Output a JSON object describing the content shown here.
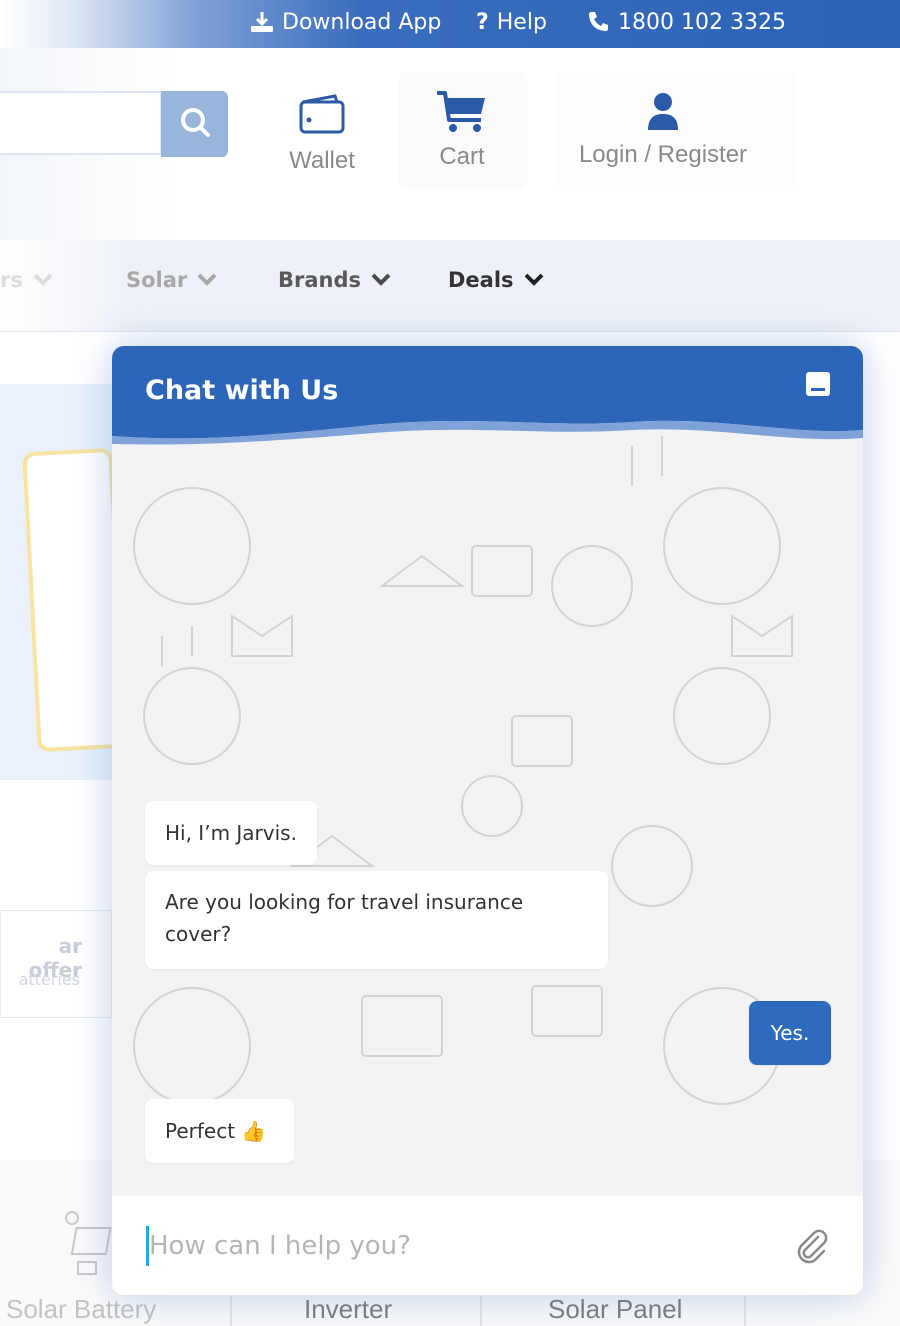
{
  "topbar": {
    "download_label": "Download App",
    "help_label": "Help",
    "phone_label": "1800 102 3325"
  },
  "header": {
    "search": {
      "value": "",
      "placeholder": ""
    },
    "wallet_label": "Wallet",
    "cart_label": "Cart",
    "login_label": "Login / Register"
  },
  "nav": {
    "items": [
      {
        "label": "rs"
      },
      {
        "label": "Solar"
      },
      {
        "label": "Brands"
      },
      {
        "label": "Deals"
      }
    ]
  },
  "background": {
    "offer_title": "ar offer",
    "offer_sub": "atteries",
    "categories": [
      "Solar Battery",
      "Inverter",
      "Solar Panel"
    ]
  },
  "chat": {
    "title": "Chat with Us",
    "messages": [
      {
        "from": "bot",
        "text": "Hi, I’m Jarvis."
      },
      {
        "from": "bot",
        "text": "Are you looking for travel insurance cover?",
        "line1": "Are you looking for travel insurance",
        "line2": "cover?"
      },
      {
        "from": "user",
        "text": "Yes."
      },
      {
        "from": "bot",
        "text": "Perfect",
        "emoji": "👍"
      }
    ],
    "input": {
      "value": "",
      "placeholder": "How can I help you?"
    }
  },
  "colors": {
    "brand_blue": "#2b62b6",
    "nav_dark": "#3d3d3d",
    "nav_mid": "#5a5a5a",
    "nav_light": "#a8a8a8",
    "icon_blue": "#2a5aa8",
    "cursor": "#2aa6e8"
  },
  "icons": [
    "download-icon",
    "help-icon",
    "phone-icon",
    "search-icon",
    "wallet-icon",
    "cart-icon",
    "user-icon",
    "chevron-down-icon",
    "minimize-icon",
    "paperclip-icon"
  ]
}
